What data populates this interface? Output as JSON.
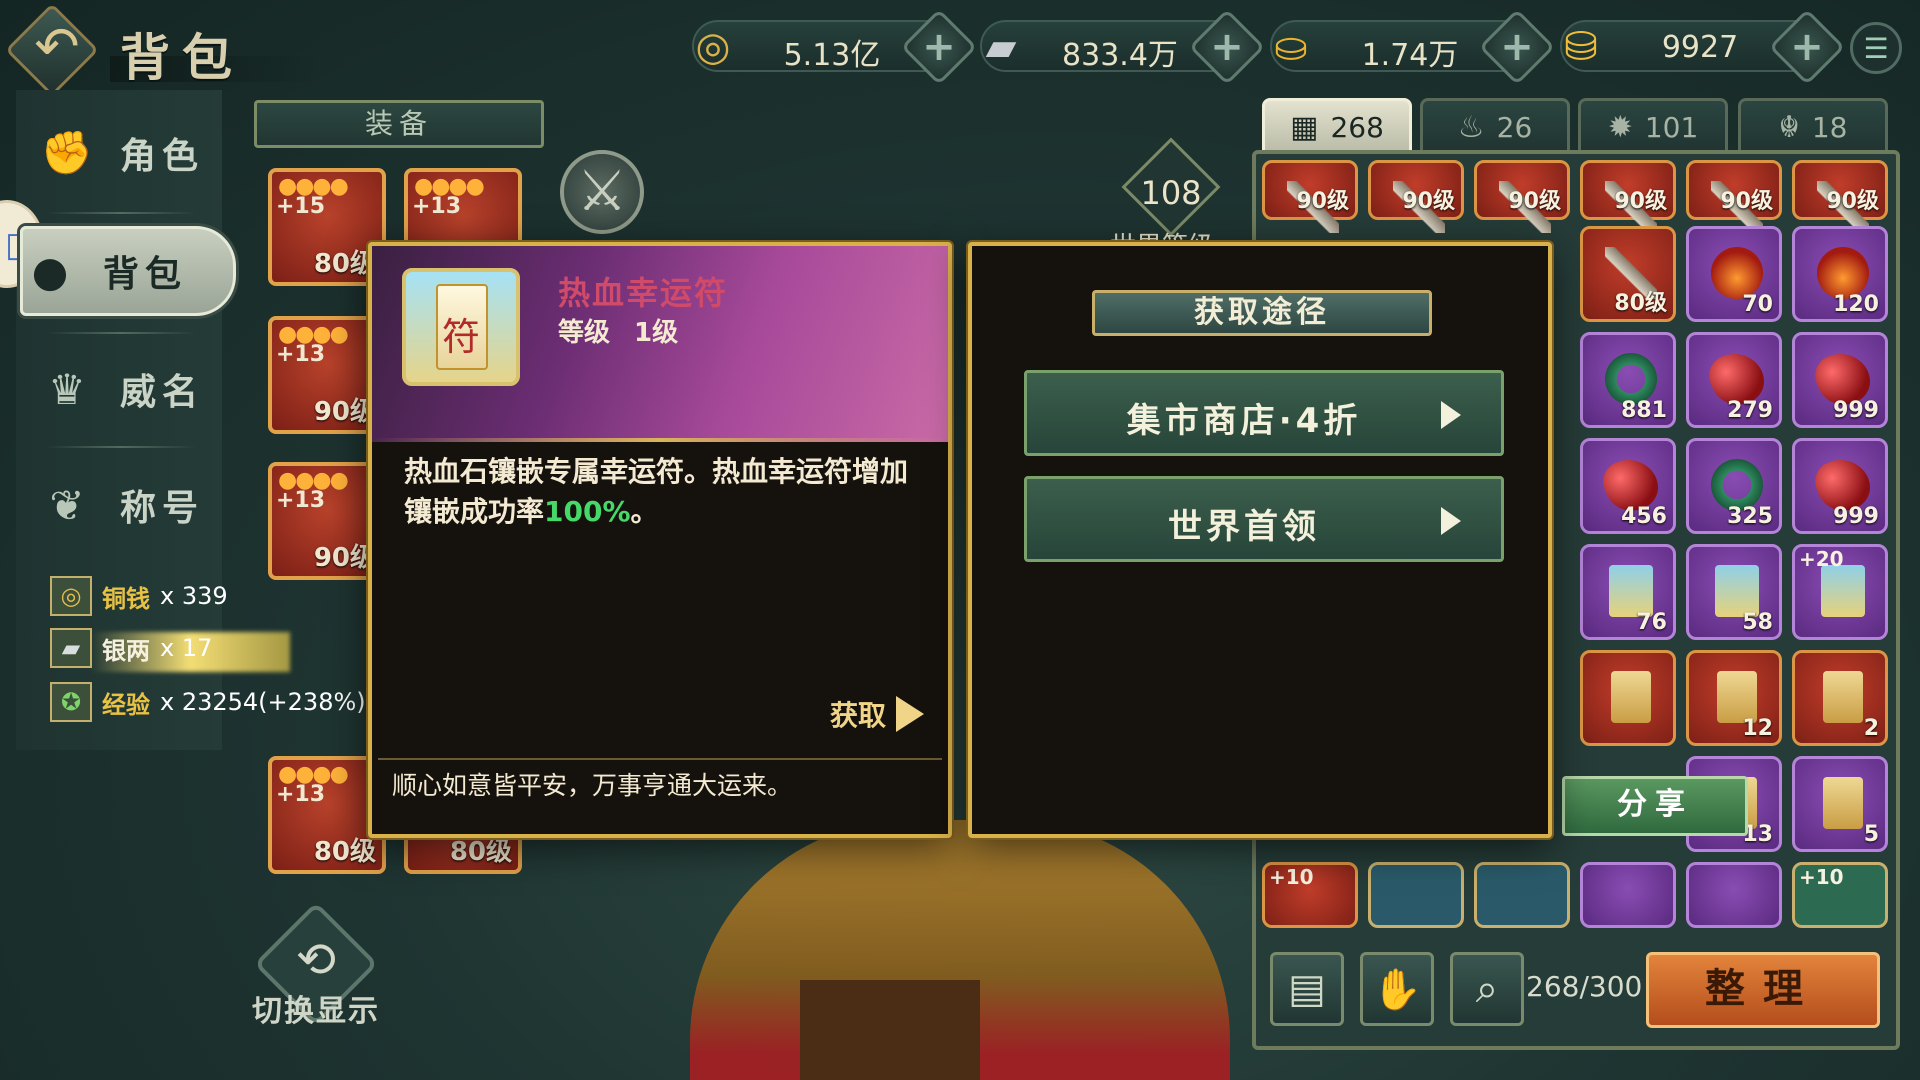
{
  "header": {
    "title": "背包",
    "currencies": [
      {
        "icon": "copper-coin-icon",
        "value": "5.13亿"
      },
      {
        "icon": "silver-ingot-icon",
        "value": "833.4万"
      },
      {
        "icon": "gold-ingot-icon",
        "value": "1.74万"
      },
      {
        "icon": "yuanbao-icon",
        "value": "9927"
      }
    ]
  },
  "sidebar": {
    "items": [
      {
        "label": "角色",
        "icon": "fist-icon"
      },
      {
        "label": "背包",
        "icon": "bag-icon",
        "active": true
      },
      {
        "label": "威名",
        "icon": "crest-icon"
      },
      {
        "label": "称号",
        "icon": "emblem-icon"
      }
    ],
    "switch_label": "切换显示"
  },
  "rewards": [
    {
      "name": "铜钱",
      "count": "x 339"
    },
    {
      "name": "银两",
      "count": "x 17"
    },
    {
      "name": "经验",
      "count": "x 23254(+238%)"
    }
  ],
  "equipment": {
    "tab_label": "装备",
    "slots": [
      {
        "plus": "+15",
        "level": "80级"
      },
      {
        "plus": "+13",
        "level": ""
      },
      {
        "plus": "+13",
        "level": "90级"
      },
      {
        "plus": "+13",
        "level": "90级"
      },
      {
        "plus": "+13",
        "level": "80级"
      },
      {
        "plus": "",
        "level": "80级"
      }
    ],
    "world_level": "108",
    "world_level_label": "世界等级"
  },
  "inventory": {
    "tabs": [
      {
        "label": "268",
        "icon": "grid-icon",
        "active": true
      },
      {
        "label": "26",
        "icon": "flame-icon"
      },
      {
        "label": "101",
        "icon": "gear-icon"
      },
      {
        "label": "18",
        "icon": "pet-icon"
      }
    ],
    "capacity": "268/300",
    "sort_label": "整理",
    "share_label": "分享",
    "visible_cells": [
      {
        "count": "90级"
      },
      {
        "count": "90级"
      },
      {
        "count": "90级"
      },
      {
        "count": "90级"
      },
      {
        "count": "90级"
      },
      {
        "count": "90级"
      },
      {
        "count": "80级"
      },
      {
        "count": "70"
      },
      {
        "count": "120"
      },
      {
        "count": "881"
      },
      {
        "count": "279"
      },
      {
        "count": "999"
      },
      {
        "count": "456"
      },
      {
        "count": "325"
      },
      {
        "count": "999"
      },
      {
        "count": "76"
      },
      {
        "count": "58"
      },
      {
        "plus": "+20"
      },
      {
        "count": ""
      },
      {
        "count": "12"
      },
      {
        "count": "2"
      },
      {
        "count": "13"
      },
      {
        "count": "5"
      },
      {
        "plus": "+10"
      },
      {
        "plus": "+10"
      }
    ]
  },
  "item_popup": {
    "name": "热血幸运符",
    "level_label": "等级",
    "level_value": "1级",
    "desc_part1": "热血石镶嵌专属幸运符。热血幸运符增加镶嵌成功率",
    "desc_highlight": "100%",
    "desc_part2": "。",
    "get_label": "获取",
    "flavor": "顺心如意皆平安，万事亨通大运来。"
  },
  "acquisition_popup": {
    "title": "获取途径",
    "sources": [
      {
        "label": "集市商店·4折"
      },
      {
        "label": "世界首领"
      }
    ]
  },
  "colors": {
    "gold_border": "#d8b14a",
    "highlight_green": "#46d96a",
    "item_name_pink": "#d04a6a"
  }
}
